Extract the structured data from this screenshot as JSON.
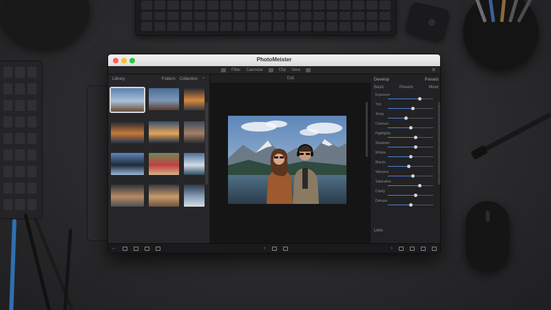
{
  "window": {
    "title": "PhotoMeister",
    "traffic_colors": [
      "#fe5f57",
      "#febc2e",
      "#28c840"
    ]
  },
  "menubar": {
    "items": [
      "Filter",
      "Calendar",
      "Clip",
      "View"
    ],
    "close_glyph": "✕"
  },
  "library": {
    "header_label": "Library",
    "header_right": [
      "Folders",
      "Collection"
    ],
    "thumbnails": [
      {
        "kind": "couple-selfie",
        "selected": true
      },
      {
        "kind": "couple-lake"
      },
      {
        "kind": "road-sunset"
      },
      {
        "kind": "lake-dusk"
      },
      {
        "kind": "lake-sunrise"
      },
      {
        "kind": "portrait-person"
      },
      {
        "kind": "person-silhouette"
      },
      {
        "kind": "woman-portrait"
      },
      {
        "kind": "mountain-lake"
      },
      {
        "kind": "shore-dusk"
      },
      {
        "kind": "desert-dusk"
      },
      {
        "kind": "mountain-mist"
      }
    ]
  },
  "center": {
    "header_label": "Edit"
  },
  "adjust": {
    "header_label": "Develop",
    "header_right": "Presets",
    "tabs": [
      "Basic",
      "Presets",
      "Mixer"
    ],
    "sliders": [
      {
        "label": "Exposure",
        "value": 0.7
      },
      {
        "label": "Tint",
        "value": 0.55
      },
      {
        "label": "Temp",
        "value": 0.4
      },
      {
        "label": "Contrast",
        "value": 0.5
      },
      {
        "label": "Highlights",
        "value": 0.6
      },
      {
        "label": "Shadows",
        "value": 0.6
      },
      {
        "label": "Whites",
        "value": 0.5
      },
      {
        "label": "Blacks",
        "value": 0.45
      },
      {
        "label": "Vibrance",
        "value": 0.55
      },
      {
        "label": "Saturation",
        "value": 0.7
      },
      {
        "label": "Clarity",
        "value": 0.6
      },
      {
        "label": "Dehaze",
        "value": 0.5
      }
    ],
    "section_label": "Lens"
  },
  "bottombar": {
    "back_glyph": "←",
    "prev_glyph": "‹",
    "next_glyph": "›"
  }
}
